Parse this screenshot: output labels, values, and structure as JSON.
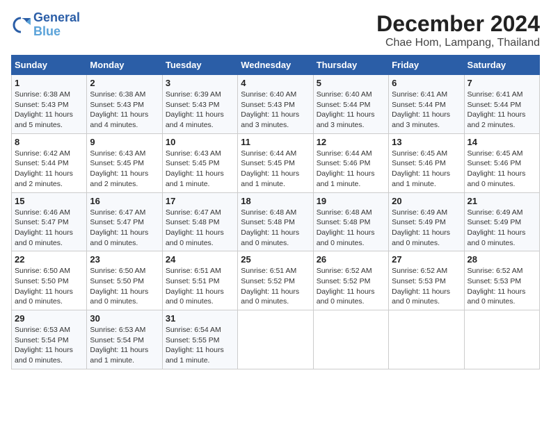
{
  "header": {
    "logo_line1": "General",
    "logo_line2": "Blue",
    "month": "December 2024",
    "location": "Chae Hom, Lampang, Thailand"
  },
  "weekdays": [
    "Sunday",
    "Monday",
    "Tuesday",
    "Wednesday",
    "Thursday",
    "Friday",
    "Saturday"
  ],
  "weeks": [
    [
      {
        "day": "1",
        "sunrise": "6:38 AM",
        "sunset": "5:43 PM",
        "daylight": "11 hours and 5 minutes."
      },
      {
        "day": "2",
        "sunrise": "6:38 AM",
        "sunset": "5:43 PM",
        "daylight": "11 hours and 4 minutes."
      },
      {
        "day": "3",
        "sunrise": "6:39 AM",
        "sunset": "5:43 PM",
        "daylight": "11 hours and 4 minutes."
      },
      {
        "day": "4",
        "sunrise": "6:40 AM",
        "sunset": "5:43 PM",
        "daylight": "11 hours and 3 minutes."
      },
      {
        "day": "5",
        "sunrise": "6:40 AM",
        "sunset": "5:44 PM",
        "daylight": "11 hours and 3 minutes."
      },
      {
        "day": "6",
        "sunrise": "6:41 AM",
        "sunset": "5:44 PM",
        "daylight": "11 hours and 3 minutes."
      },
      {
        "day": "7",
        "sunrise": "6:41 AM",
        "sunset": "5:44 PM",
        "daylight": "11 hours and 2 minutes."
      }
    ],
    [
      {
        "day": "8",
        "sunrise": "6:42 AM",
        "sunset": "5:44 PM",
        "daylight": "11 hours and 2 minutes."
      },
      {
        "day": "9",
        "sunrise": "6:43 AM",
        "sunset": "5:45 PM",
        "daylight": "11 hours and 2 minutes."
      },
      {
        "day": "10",
        "sunrise": "6:43 AM",
        "sunset": "5:45 PM",
        "daylight": "11 hours and 1 minute."
      },
      {
        "day": "11",
        "sunrise": "6:44 AM",
        "sunset": "5:45 PM",
        "daylight": "11 hours and 1 minute."
      },
      {
        "day": "12",
        "sunrise": "6:44 AM",
        "sunset": "5:46 PM",
        "daylight": "11 hours and 1 minute."
      },
      {
        "day": "13",
        "sunrise": "6:45 AM",
        "sunset": "5:46 PM",
        "daylight": "11 hours and 1 minute."
      },
      {
        "day": "14",
        "sunrise": "6:45 AM",
        "sunset": "5:46 PM",
        "daylight": "11 hours and 0 minutes."
      }
    ],
    [
      {
        "day": "15",
        "sunrise": "6:46 AM",
        "sunset": "5:47 PM",
        "daylight": "11 hours and 0 minutes."
      },
      {
        "day": "16",
        "sunrise": "6:47 AM",
        "sunset": "5:47 PM",
        "daylight": "11 hours and 0 minutes."
      },
      {
        "day": "17",
        "sunrise": "6:47 AM",
        "sunset": "5:48 PM",
        "daylight": "11 hours and 0 minutes."
      },
      {
        "day": "18",
        "sunrise": "6:48 AM",
        "sunset": "5:48 PM",
        "daylight": "11 hours and 0 minutes."
      },
      {
        "day": "19",
        "sunrise": "6:48 AM",
        "sunset": "5:48 PM",
        "daylight": "11 hours and 0 minutes."
      },
      {
        "day": "20",
        "sunrise": "6:49 AM",
        "sunset": "5:49 PM",
        "daylight": "11 hours and 0 minutes."
      },
      {
        "day": "21",
        "sunrise": "6:49 AM",
        "sunset": "5:49 PM",
        "daylight": "11 hours and 0 minutes."
      }
    ],
    [
      {
        "day": "22",
        "sunrise": "6:50 AM",
        "sunset": "5:50 PM",
        "daylight": "11 hours and 0 minutes."
      },
      {
        "day": "23",
        "sunrise": "6:50 AM",
        "sunset": "5:50 PM",
        "daylight": "11 hours and 0 minutes."
      },
      {
        "day": "24",
        "sunrise": "6:51 AM",
        "sunset": "5:51 PM",
        "daylight": "11 hours and 0 minutes."
      },
      {
        "day": "25",
        "sunrise": "6:51 AM",
        "sunset": "5:52 PM",
        "daylight": "11 hours and 0 minutes."
      },
      {
        "day": "26",
        "sunrise": "6:52 AM",
        "sunset": "5:52 PM",
        "daylight": "11 hours and 0 minutes."
      },
      {
        "day": "27",
        "sunrise": "6:52 AM",
        "sunset": "5:53 PM",
        "daylight": "11 hours and 0 minutes."
      },
      {
        "day": "28",
        "sunrise": "6:52 AM",
        "sunset": "5:53 PM",
        "daylight": "11 hours and 0 minutes."
      }
    ],
    [
      {
        "day": "29",
        "sunrise": "6:53 AM",
        "sunset": "5:54 PM",
        "daylight": "11 hours and 0 minutes."
      },
      {
        "day": "30",
        "sunrise": "6:53 AM",
        "sunset": "5:54 PM",
        "daylight": "11 hours and 1 minute."
      },
      {
        "day": "31",
        "sunrise": "6:54 AM",
        "sunset": "5:55 PM",
        "daylight": "11 hours and 1 minute."
      },
      null,
      null,
      null,
      null
    ]
  ]
}
